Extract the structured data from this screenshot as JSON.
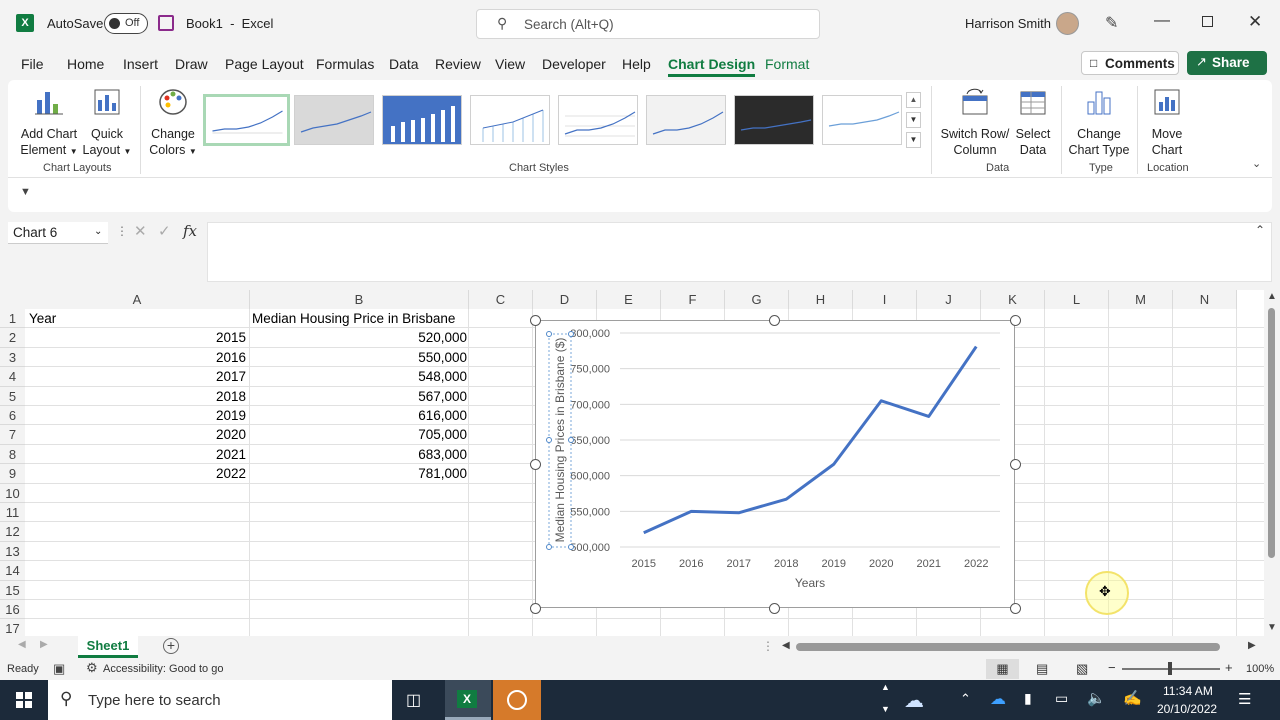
{
  "titlebar": {
    "autosave_label": "AutoSave",
    "autosave_state": "Off",
    "doc_title": "Book1  -  Excel",
    "search_placeholder": "Search (Alt+Q)",
    "user_name": "Harrison Smith"
  },
  "menu": {
    "items": [
      "File",
      "Home",
      "Insert",
      "Draw",
      "Page Layout",
      "Formulas",
      "Data",
      "Review",
      "View",
      "Developer",
      "Help",
      "Chart Design",
      "Format"
    ],
    "active": "Chart Design",
    "comments_label": "Comments",
    "share_label": "Share"
  },
  "ribbon": {
    "add_chart_element": [
      "Add Chart",
      "Element"
    ],
    "quick_layout": [
      "Quick",
      "Layout"
    ],
    "change_colors": [
      "Change",
      "Colors"
    ],
    "switch_row_column": [
      "Switch Row/",
      "Column"
    ],
    "select_data": [
      "Select",
      "Data"
    ],
    "change_chart_type": [
      "Change",
      "Chart Type"
    ],
    "move_chart": [
      "Move",
      "Chart"
    ],
    "groups": {
      "chart_layouts": "Chart Layouts",
      "chart_styles": "Chart Styles",
      "data": "Data",
      "type": "Type",
      "location": "Location"
    }
  },
  "formula_bar": {
    "name_box": "Chart 6",
    "fx": "fx",
    "value": ""
  },
  "columns": [
    "A",
    "B",
    "C",
    "D",
    "E",
    "F",
    "G",
    "H",
    "I",
    "J",
    "K",
    "L",
    "M",
    "N"
  ],
  "rows": [
    "1",
    "2",
    "3",
    "4",
    "5",
    "6",
    "7",
    "8",
    "9",
    "10",
    "11",
    "12",
    "13",
    "14",
    "15",
    "16",
    "17"
  ],
  "cells": {
    "A1": "Year",
    "B1": "Median Housing Price in Brisbane",
    "years": [
      "2015",
      "2016",
      "2017",
      "2018",
      "2019",
      "2020",
      "2021",
      "2022"
    ],
    "prices": [
      "520,000",
      "550,000",
      "548,000",
      "567,000",
      "616,000",
      "705,000",
      "683,000",
      "781,000"
    ]
  },
  "chart_data": {
    "type": "line",
    "categories": [
      "2015",
      "2016",
      "2017",
      "2018",
      "2019",
      "2020",
      "2021",
      "2022"
    ],
    "series": [
      {
        "values": [
          520000,
          550000,
          548000,
          567000,
          616000,
          705000,
          683000,
          781000
        ]
      }
    ],
    "title": "",
    "xlabel": "Years",
    "ylabel": "Median Housing Prices in Brisbane ($)",
    "ylim": [
      500000,
      800000
    ],
    "yticks": [
      "500,000",
      "550,000",
      "600,000",
      "650,000",
      "700,000",
      "750,000",
      "800,000"
    ],
    "grid": true,
    "line_color": "#4472c4"
  },
  "sheets": {
    "tabs": [
      "Sheet1"
    ],
    "active": "Sheet1"
  },
  "status": {
    "ready": "Ready",
    "accessibility": "Accessibility: Good to go",
    "zoom": "100%"
  },
  "taskbar": {
    "search_placeholder": "Type here to search",
    "time": "11:34 AM",
    "date": "20/10/2022"
  },
  "colors": {
    "excel_green": "#107c41",
    "share_green": "#1e7145",
    "chart_blue": "#4472c4"
  }
}
